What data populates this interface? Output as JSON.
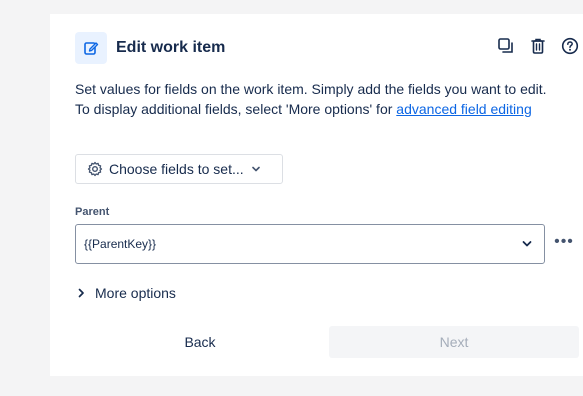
{
  "header": {
    "title": "Edit work item",
    "icon": "edit-icon",
    "actions": [
      "duplicate-icon",
      "delete-icon",
      "help-icon"
    ]
  },
  "description": {
    "line1": "Set values for fields on the work item. Simply add the fields you want to edit.",
    "line2_prefix": "To display additional fields, select 'More options' for ",
    "line2_link": "advanced field editing"
  },
  "choose_fields": {
    "label": "Choose fields to set..."
  },
  "parent_field": {
    "label": "Parent",
    "value": "{{ParentKey}}",
    "more_label": "•••"
  },
  "more_options": {
    "label": "More options"
  },
  "footer": {
    "back_label": "Back",
    "next_label": "Next"
  },
  "colors": {
    "link": "#0c66e4",
    "icon_bg": "#e9f2ff",
    "text": "#172b4d",
    "disabled_text": "#a5adba"
  }
}
